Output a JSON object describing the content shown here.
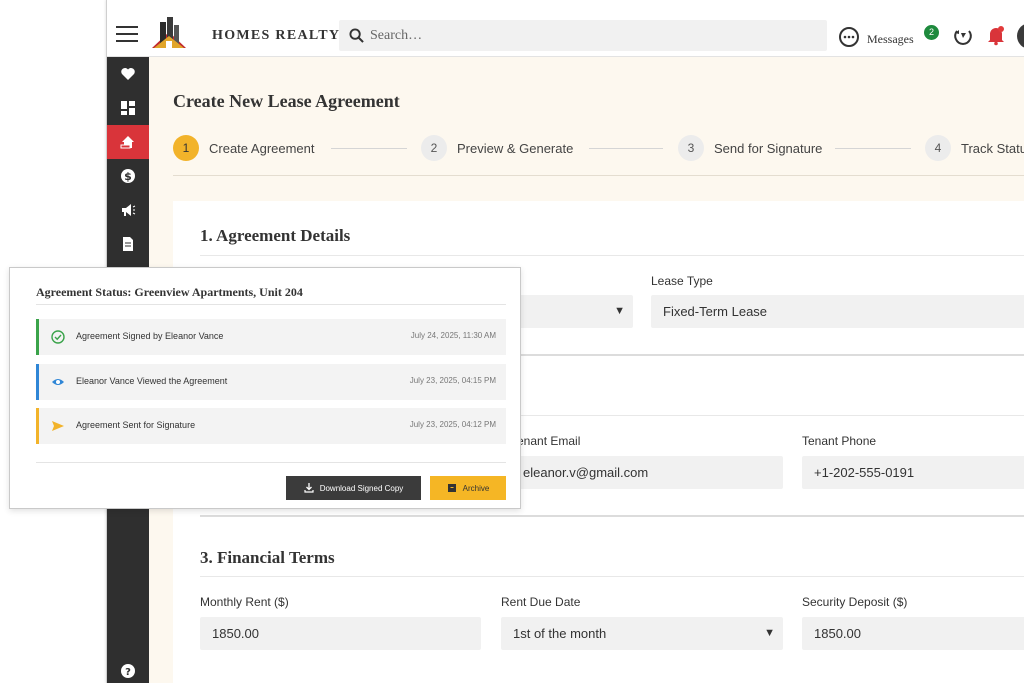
{
  "header": {
    "brand": "HOMES REALTY",
    "search_placeholder": "Search…",
    "messages_label": "Messages",
    "messages_count": "2"
  },
  "sidebar": {
    "items": [
      {
        "icon": "heart-icon"
      },
      {
        "icon": "dashboard-icon"
      },
      {
        "icon": "lease-icon",
        "active": true
      },
      {
        "icon": "dollar-icon"
      },
      {
        "icon": "megaphone-icon"
      },
      {
        "icon": "document-icon"
      }
    ],
    "help_icon": "help-icon"
  },
  "page": {
    "title": "Create New Lease Agreement",
    "steps": [
      {
        "number": "1",
        "label": "Create Agreement"
      },
      {
        "number": "2",
        "label": "Preview & Generate"
      },
      {
        "number": "3",
        "label": "Send for Signature"
      },
      {
        "number": "4",
        "label": "Track Status"
      }
    ],
    "active_step": 1
  },
  "form": {
    "section1_title": "1. Agreement Details",
    "lease_type_label": "Lease Type",
    "lease_type_value": "Fixed-Term Lease",
    "tenant_email_label": "Tenant Email",
    "tenant_email_value": "eleanor.v@gmail.com",
    "tenant_phone_label": "Tenant Phone",
    "tenant_phone_value": "+1-202-555-0191",
    "section3_title": "3. Financial Terms",
    "monthly_rent_label": "Monthly Rent ($)",
    "monthly_rent_value": "1850.00",
    "rent_due_label": "Rent Due Date",
    "rent_due_value": "1st of the month",
    "deposit_label": "Security Deposit ($)",
    "deposit_value": "1850.00"
  },
  "status_panel": {
    "title": "Agreement Status: Greenview Apartments, Unit 204",
    "events": [
      {
        "text": "Agreement Signed by Eleanor Vance",
        "time": "July 24, 2025, 11:30 AM",
        "color": "#3aa34a",
        "icon": "check-circle-icon"
      },
      {
        "text": "Eleanor Vance Viewed the Agreement",
        "time": "July 23, 2025, 04:15 PM",
        "color": "#2f86d6",
        "icon": "eye-icon"
      },
      {
        "text": "Agreement Sent for Signature",
        "time": "July 23, 2025, 04:12 PM",
        "color": "#f2b32a",
        "icon": "send-icon"
      }
    ],
    "download_label": "Download Signed Copy",
    "archive_label": "Archive"
  },
  "colors": {
    "accent": "#f2b32a",
    "sidebar_active": "#d9343a",
    "sidebar_bg": "#2f2f2f"
  }
}
